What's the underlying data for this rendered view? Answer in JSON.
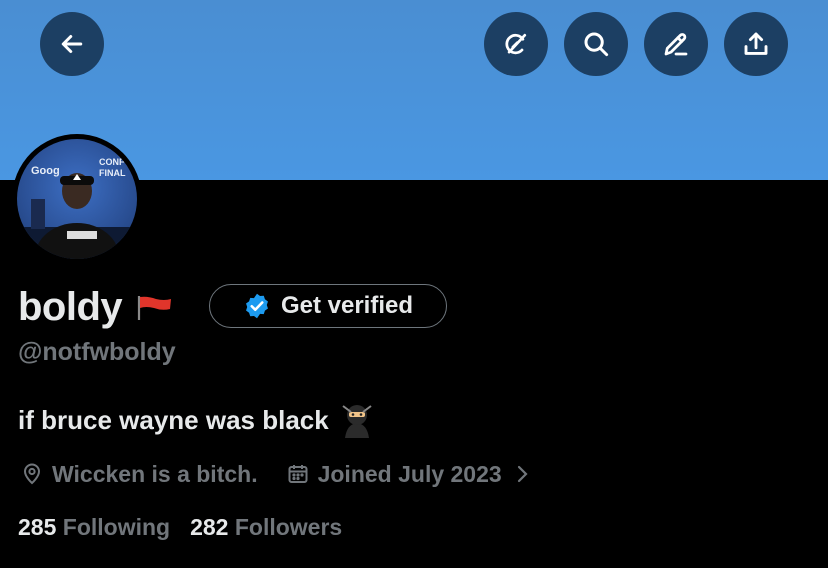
{
  "header": {
    "back_icon": "arrow-left-icon",
    "actions": [
      {
        "icon": "grok-icon"
      },
      {
        "icon": "search-icon"
      },
      {
        "icon": "edit-icon"
      },
      {
        "icon": "share-icon"
      }
    ],
    "colors": {
      "banner": "#4a8ed2",
      "button": "#1c3f63"
    }
  },
  "profile": {
    "avatar_text_1": "Goog",
    "avatar_text_2": "CONF",
    "avatar_text_3": "FINAL",
    "name": "boldy",
    "flag_emoji": "red-flag",
    "verify_label": "Get verified",
    "handle": "@notfwboldy",
    "bio": "if bruce wayne was black",
    "bio_emoji": "ninja",
    "location": "Wiccken is a bitch.",
    "joined": "Joined July 2023",
    "following_count": "285",
    "following_label": "Following",
    "followers_count": "282",
    "followers_label": "Followers",
    "accent_color": "#1d9bf0"
  }
}
